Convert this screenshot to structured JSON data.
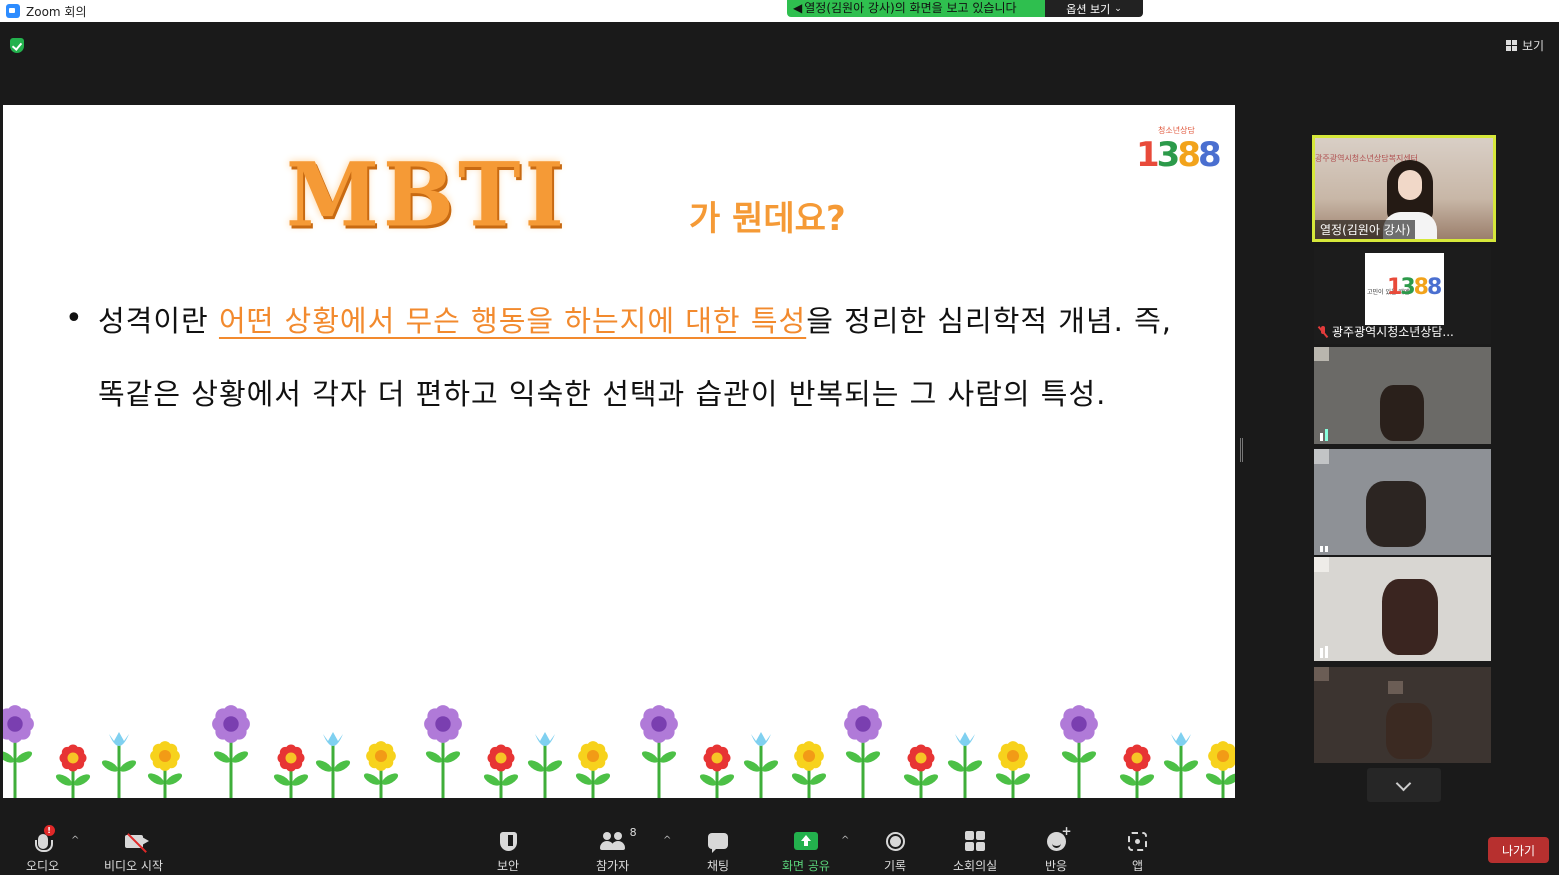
{
  "window": {
    "title": "Zoom 회의"
  },
  "share_banner": {
    "viewing_text": "열정(김원아 강사)의 화면을 보고 있습니다",
    "options_label": "옵션 보기"
  },
  "topbar": {
    "view_label": "보기"
  },
  "slide": {
    "title_main": "MBTI",
    "title_sub": "가 뭔데요?",
    "logo_small": "청소년상담",
    "logo_number": [
      "1",
      "3",
      "8",
      "8"
    ],
    "bullet": "•",
    "text_before": "성격이란 ",
    "text_highlight": "어떤 상황에서 무슨 행동을 하는지에 대한 특성",
    "text_after": "을 정리한 심리학적 개념. 즉, 똑같은 상황에서 각자 더 편하고 익숙한 선택과 습관이 반복되는 그 사람의 특성."
  },
  "participants": {
    "speaker": {
      "label": "열정(김원아 강사)",
      "banner": "광주광역시청소년상담복지센터"
    },
    "org": {
      "label": "광주광역시청소년상담...",
      "logo_small": "고민이 있을 때엔",
      "logo_number": [
        "1",
        "3",
        "8",
        "8"
      ]
    }
  },
  "toolbar": {
    "audio": "오디오",
    "video": "비디오 시작",
    "security": "보안",
    "participants": "참가자",
    "participants_count": "8",
    "chat": "채팅",
    "share": "화면 공유",
    "record": "기록",
    "breakout": "소회의실",
    "reactions": "반응",
    "apps": "앱",
    "leave": "나가기"
  },
  "colors": {
    "accent_green": "#23b14d",
    "speaker_border": "#d6e83a",
    "slide_orange": "#f59a36",
    "leave_red": "#b7302f"
  }
}
